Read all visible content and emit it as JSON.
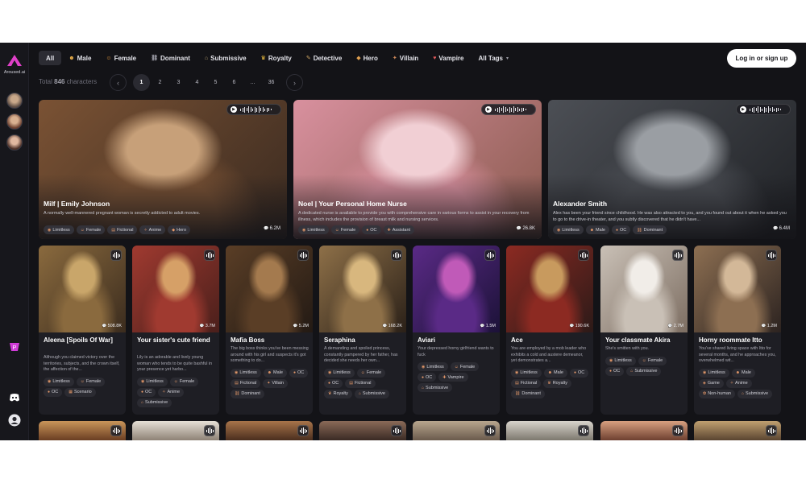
{
  "brand": {
    "name": "Aroused.ai"
  },
  "tags": [
    {
      "label": "All",
      "icon": "",
      "active": true
    },
    {
      "label": "Male",
      "icon": "☻"
    },
    {
      "label": "Female",
      "icon": "☺"
    },
    {
      "label": "Dominant",
      "icon": "⛓"
    },
    {
      "label": "Submissive",
      "icon": "⌂"
    },
    {
      "label": "Royalty",
      "icon": "♛"
    },
    {
      "label": "Detective",
      "icon": "✎"
    },
    {
      "label": "Hero",
      "icon": "◆"
    },
    {
      "label": "Villain",
      "icon": "✦"
    },
    {
      "label": "Vampire",
      "icon": "♥"
    },
    {
      "label": "All Tags",
      "icon": ""
    }
  ],
  "login_label": "Log in or sign up",
  "total": {
    "prefix": "Total",
    "count": "846",
    "suffix": "characters"
  },
  "pagination": {
    "pages": [
      "1",
      "2",
      "3",
      "4",
      "5",
      "6",
      "...",
      "36"
    ],
    "current": "1"
  },
  "featured": [
    {
      "title": "Milf | Emily Johnson",
      "desc": "A normally well-mannered pregnant woman is secretly addicted to adult movies.",
      "tags": [
        "Limitless",
        "Female",
        "Fictional",
        "Anime",
        "Hero"
      ],
      "count": "6.2M",
      "palette": [
        "#c7a079",
        "#7a5234",
        "#3a2a20"
      ]
    },
    {
      "title": "Noel | Your Personal Home Nurse",
      "desc": "A dedicated nurse is available to provide you with comprehensive care in various forms to assist in your recovery from illness, which includes the provision of breast milk and nursing services.",
      "tags": [
        "Limitless",
        "Female",
        "OC",
        "Assistant"
      ],
      "count": "26.8K",
      "palette": [
        "#f1cfd4",
        "#d8909e",
        "#8a5a4e"
      ]
    },
    {
      "title": "Alexander Smith",
      "desc": "Alex has been your friend since childhood. He was also attracted to you, and you found out about it when he asked you to go to the drive-in theater, and you subtly discovered that he didn't have...",
      "tags": [
        "Limitless",
        "Male",
        "OC",
        "Dominant"
      ],
      "count": "6.4M",
      "palette": [
        "#9a9ea3",
        "#4c4f55",
        "#1f2125"
      ]
    }
  ],
  "cards": [
    {
      "title": "Aleena [Spoils Of War]",
      "desc": "Although you claimed victory over the territories, subjects, and the crown itself, the affection of the...",
      "tags": [
        "Limitless",
        "Female",
        "OC",
        "Scenario"
      ],
      "count": "508.8K",
      "palette": [
        "#c9a66a",
        "#8a6a3e",
        "#3b2c1e"
      ]
    },
    {
      "title": "Your sister's cute friend",
      "desc": "Lily is an adorable and lively young woman who tends to be quite bashful in your presence yet harbo...",
      "tags": [
        "Limitless",
        "Female",
        "OC",
        "Anime",
        "Submissive"
      ],
      "count": "3.7M",
      "palette": [
        "#d6a067",
        "#a03a30",
        "#4a1f1b"
      ]
    },
    {
      "title": "Mafia Boss",
      "desc": "The big boss thinks you've been messing around with his girl and suspects it's got something to do...",
      "tags": [
        "Limitless",
        "Male",
        "OC",
        "Fictional",
        "Villain",
        "Dominant"
      ],
      "count": "5.2M",
      "palette": [
        "#a47a4e",
        "#5a3e26",
        "#231a14"
      ]
    },
    {
      "title": "Seraphina",
      "desc": "A demanding and spoiled princess, constantly pampered by her father, has decided she needs her own...",
      "tags": [
        "Limitless",
        "Female",
        "OC",
        "Fictional",
        "Royalty",
        "Submissive"
      ],
      "count": "168.2K",
      "palette": [
        "#d8b77e",
        "#8e7048",
        "#2a2018"
      ]
    },
    {
      "title": "Aviari",
      "desc": "Your depressed horny girlfriend wants to fuck",
      "tags": [
        "Limitless",
        "Female",
        "OC",
        "Vampire",
        "Submissive"
      ],
      "count": "1.5M",
      "palette": [
        "#c05ab8",
        "#5a2a86",
        "#1c1238"
      ]
    },
    {
      "title": "Ace",
      "desc": "You are employed by a mob leader who exhibits a cold and austere demeanor, yet demonstrates a...",
      "tags": [
        "Limitless",
        "Male",
        "OC",
        "Fictional",
        "Royalty",
        "Dominant"
      ],
      "count": "190.6K",
      "palette": [
        "#c89a5e",
        "#8c2a22",
        "#2c1a18"
      ]
    },
    {
      "title": "Your classmate Akira",
      "desc": "She's smitten with you.",
      "tags": [
        "Limitless",
        "Female",
        "OC",
        "Submissive"
      ],
      "count": "2.7M",
      "palette": [
        "#f1ede8",
        "#c9c0b6",
        "#7d6e62"
      ]
    },
    {
      "title": "Horny roommate Itto",
      "desc": "You've shared living space with Itto for several months, and he approaches you, overwhelmed wit...",
      "tags": [
        "Limitless",
        "Male",
        "Game",
        "Anime",
        "Non-human",
        "Submissive"
      ],
      "count": "1.2M",
      "palette": [
        "#d3b898",
        "#8d6f52",
        "#2c2320"
      ]
    }
  ],
  "bottom_palettes": [
    [
      "#c9955a",
      "#6a3e22"
    ],
    [
      "#e6e0d6",
      "#8e8276"
    ],
    [
      "#a8744a",
      "#4a2e1e"
    ],
    [
      "#8a6a58",
      "#3a2a24"
    ],
    [
      "#b8a68e",
      "#6a5a4c"
    ],
    [
      "#d8d4cc",
      "#7d786e"
    ],
    [
      "#d8a080",
      "#6e4030"
    ],
    [
      "#c0a070",
      "#5a4430"
    ]
  ]
}
